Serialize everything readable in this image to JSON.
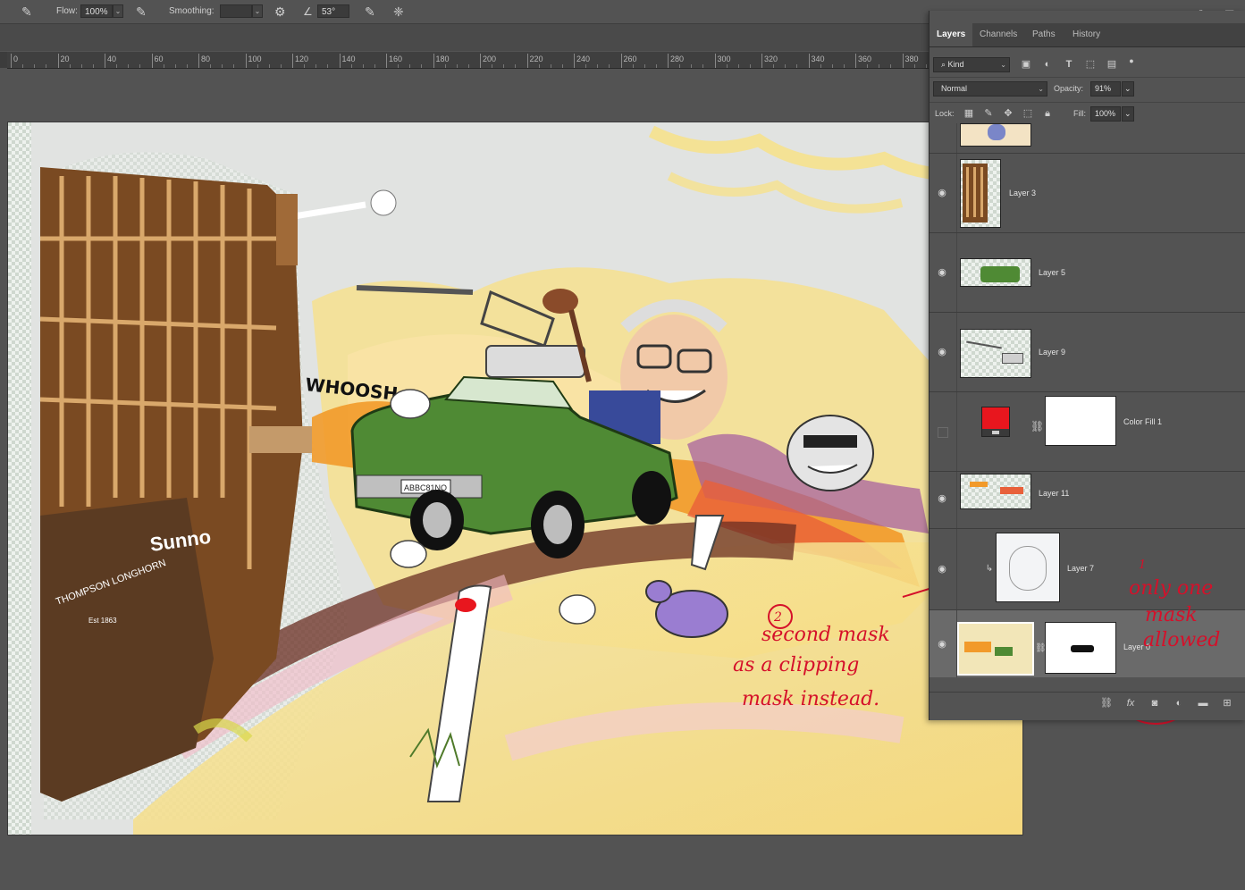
{
  "options_bar": {
    "flow_label": "Flow:",
    "flow_value": "100%",
    "smoothing_label": "Smoothing:",
    "smoothing_value": "",
    "angle_value": "53°"
  },
  "ruler": {
    "labels": [
      "0",
      "20",
      "40",
      "60",
      "80",
      "100",
      "120",
      "140",
      "160",
      "180",
      "200",
      "220",
      "240",
      "260",
      "280",
      "300",
      "320",
      "340",
      "360",
      "380"
    ]
  },
  "artwork": {
    "whoosh_text": "WHOOSH",
    "sign_brand": "Sunno",
    "sign_company": "THOMPSON LONGHORN",
    "sign_est": "Est 1863",
    "plate_text": "ABBC81NO"
  },
  "panel": {
    "tabs": [
      "Layers",
      "Channels",
      "Paths",
      "History"
    ],
    "active_tab": "Layers",
    "filter_kind": "Kind",
    "blend_mode": "Normal",
    "opacity_label": "Opacity:",
    "opacity_value": "91%",
    "lock_label": "Lock:",
    "fill_label": "Fill:",
    "fill_value": "100%"
  },
  "layers": [
    {
      "name": "",
      "visible": false
    },
    {
      "name": "Layer 3",
      "visible": true
    },
    {
      "name": "Layer 5",
      "visible": true
    },
    {
      "name": "Layer 9",
      "visible": true
    },
    {
      "name": "Color Fill 1",
      "visible": false,
      "fill_color": "#e8161e"
    },
    {
      "name": "Layer 11",
      "visible": true
    },
    {
      "name": "Layer 7",
      "visible": true,
      "clipped": true
    },
    {
      "name": "Layer 0",
      "visible": true,
      "selected": true,
      "has_mask": true
    }
  ],
  "annotations": {
    "num_one": "1",
    "note_one_line1": "only one",
    "note_one_line2": "mask",
    "note_one_line3": "allowed",
    "num_two": "2",
    "note_two_line1": "second mask",
    "note_two_line2": "as a clipping",
    "note_two_line3": "mask instead."
  },
  "colors": {
    "accent_red": "#d5102a",
    "car_green": "#4f8a34",
    "fill_red": "#e8161e"
  }
}
